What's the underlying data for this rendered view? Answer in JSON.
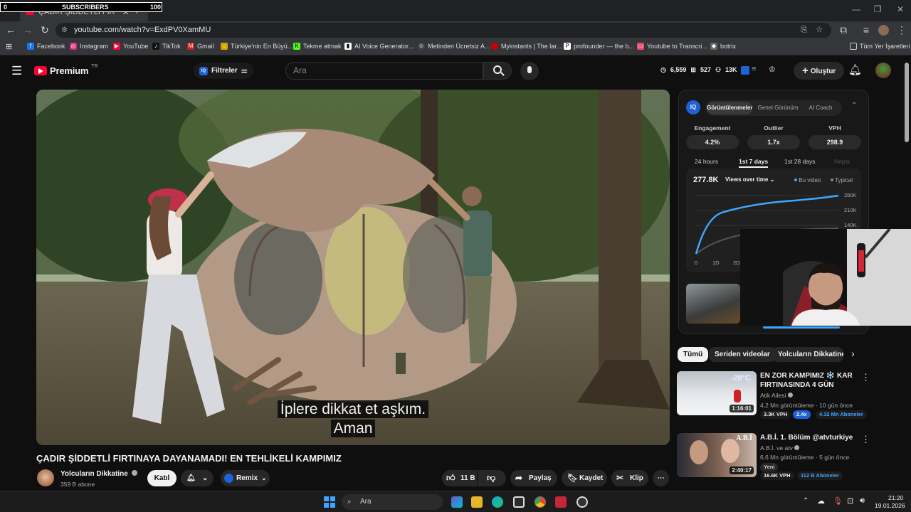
{
  "overlay": {
    "left": "0",
    "label": "SUBSCRIBERS",
    "count": "100"
  },
  "browser": {
    "tab_title": "ÇADIR ŞİDDETLİ FIRTINAYA",
    "url": "youtube.com/watch?v=ExdPV0XamMU",
    "bookmarks": [
      "Facebook",
      "Instagram",
      "YouTube",
      "TikTok",
      "Gmail",
      "Türkiye'nin En Büyü...",
      "Tekme atmak",
      "AI Voice Generator...",
      "Metinden Ücretsiz A...",
      "Myinstants | The lar...",
      "profounder — the b...",
      "Youtube to Transcri...",
      "botrix"
    ],
    "all_bookmarks": "Tüm Yer İşaretleri"
  },
  "yt": {
    "logo": "Premium",
    "logo_sup": "TR",
    "filters": "Filtreler",
    "search_placeholder": "Ara",
    "stats": {
      "views": "6,559",
      "videos": "527",
      "subs": "13K"
    },
    "create": "Oluştur"
  },
  "video": {
    "subtitle_line1": "İplere dikkat et aşkım.",
    "subtitle_line2": "Aman",
    "title": "ÇADIR ŞİDDETLİ FIRTINAYA DAYANAMADI! EN TEHLİKELİ KAMPIMIZ",
    "channel": "Yolcuların Dikkatine",
    "subscribers": "359 B abone",
    "join": "Katıl",
    "remix": "Remix",
    "likes": "11 B",
    "share": "Paylaş",
    "save": "Kaydet",
    "clip": "Klip"
  },
  "iq": {
    "tabs": [
      "Görüntülenmeler",
      "Genel Görünüm",
      "AI Coach"
    ],
    "metrics": [
      {
        "label": "Engagement",
        "value": "4.2%"
      },
      {
        "label": "Outlier",
        "value": "1.7x"
      },
      {
        "label": "VPH",
        "value": "298.9"
      }
    ],
    "ranges": [
      "24 hours",
      "1st 7 days",
      "1st 28 days",
      "Hepsi"
    ],
    "total": "277.8K",
    "selector": "Views over time",
    "legend": [
      "Bu video",
      "Typical"
    ],
    "y_ticks": [
      "280K",
      "210K",
      "140K"
    ],
    "x_ticks": [
      "0",
      "1D",
      "2D"
    ]
  },
  "chips": [
    "Tümü",
    "Seriden videolar",
    "Yolcuların Dikkatine"
  ],
  "recommendations": [
    {
      "title": "EN ZOR KAMPIMIZ ❄️ KAR FIRTINASINDA 4 GÜN",
      "channel": "Atik Ailesi",
      "meta": "4,2 Mn görüntüleme · 10 gün önce",
      "duration": "1:16:01",
      "thumb_text": "-28°C",
      "vph": "3.3K VPH",
      "outlier": "2.4x",
      "subs": "4.32 Mn Aboneler"
    },
    {
      "title": "A.B.İ. 1. Bölüm @atvturkiye",
      "channel": "A.B.İ. ve atv",
      "meta": "6,6 Mn görüntüleme · 5 gün önce",
      "duration": "2:40:17",
      "thumb_text": "A.B.İ",
      "tag": "Yeni",
      "vph": "16.6K VPH",
      "subs": "112 B Aboneler"
    }
  ],
  "taskbar": {
    "search": "Ara",
    "time": "21:20",
    "date": "19.01.2026"
  },
  "colors": {
    "accent": "#3ea6ff",
    "red": "#ff0033",
    "green_badge": "#1f5f2a",
    "iq_blue": "#1e62d8"
  }
}
